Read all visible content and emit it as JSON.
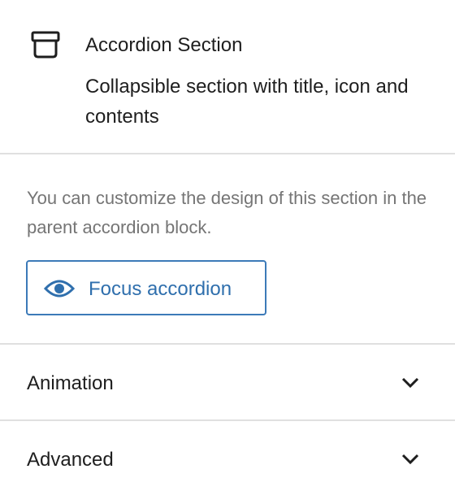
{
  "block": {
    "icon": "accordion-section-icon",
    "title": "Accordion Section",
    "description": "Collapsible section with title, icon and contents"
  },
  "info": {
    "text": "You can customize the design of this section in the parent accordion block.",
    "focus_button": {
      "icon": "eye-icon",
      "label": "Focus accordion"
    }
  },
  "panels": [
    {
      "title": "Animation",
      "icon": "chevron-down-icon",
      "expanded": false
    },
    {
      "title": "Advanced",
      "icon": "chevron-down-icon",
      "expanded": false
    }
  ],
  "colors": {
    "accent": "#2f6fad",
    "text": "#1e1e1e",
    "muted": "#757575",
    "divider": "#e0e0e0"
  }
}
